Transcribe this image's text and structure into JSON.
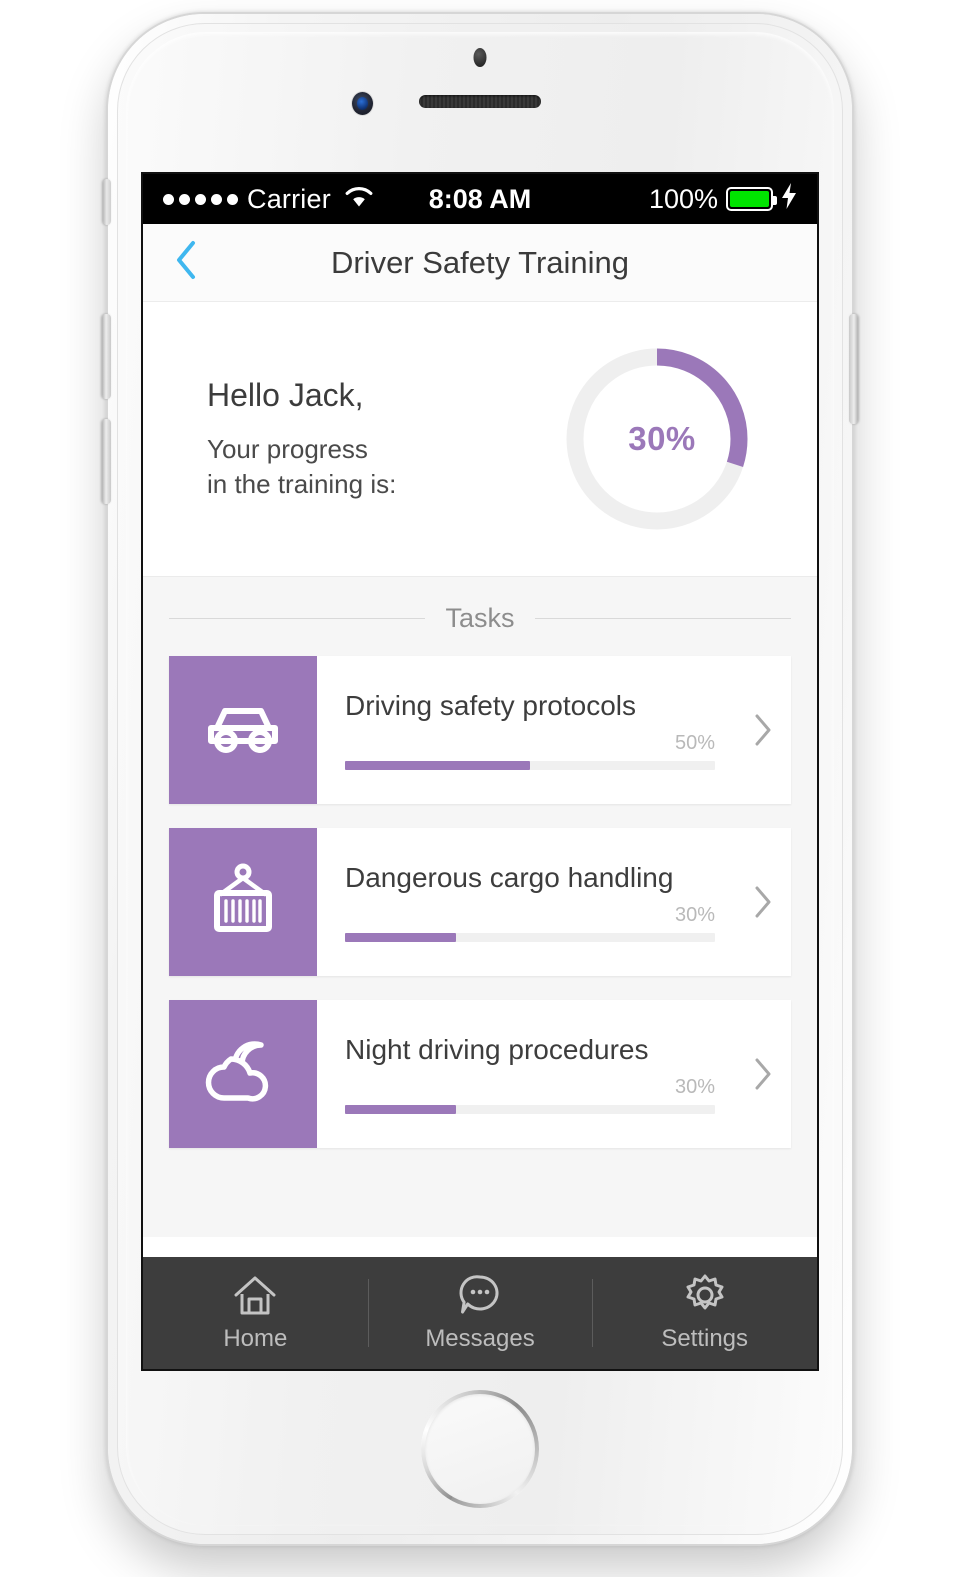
{
  "status_bar": {
    "signal_dots": 5,
    "carrier": "Carrier",
    "wifi_icon": "wifi-icon",
    "time": "8:08 AM",
    "battery_percent": "100%",
    "battery_level": 100,
    "charging_icon": "lightning-bolt-icon"
  },
  "nav": {
    "back_icon": "chevron-left-icon",
    "back_color": "#3fb7ef",
    "title": "Driver Safety Training"
  },
  "hero": {
    "greeting": "Hello Jack,",
    "subline_1": "Your progress",
    "subline_2": "in the training is:",
    "progress_label": "30%",
    "progress_value": 30,
    "ring_color": "#9b78b9",
    "ring_track_color": "#efefef"
  },
  "tasks": {
    "section_label": "Tasks",
    "items": [
      {
        "icon": "car-icon",
        "title": "Driving safety protocols",
        "percent_label": "50%",
        "percent_value": 50,
        "chevron_icon": "chevron-right-icon",
        "accent": "#9b78b9"
      },
      {
        "icon": "shipping-container-icon",
        "title": "Dangerous cargo handling",
        "percent_label": "30%",
        "percent_value": 30,
        "chevron_icon": "chevron-right-icon",
        "accent": "#9b78b9"
      },
      {
        "icon": "moon-cloud-icon",
        "title": "Night driving procedures",
        "percent_label": "30%",
        "percent_value": 30,
        "chevron_icon": "chevron-right-icon",
        "accent": "#9b78b9"
      }
    ]
  },
  "tabbar": {
    "items": [
      {
        "icon": "home-icon",
        "label": "Home"
      },
      {
        "icon": "messages-icon",
        "label": "Messages"
      },
      {
        "icon": "settings-gear-icon",
        "label": "Settings"
      }
    ]
  }
}
